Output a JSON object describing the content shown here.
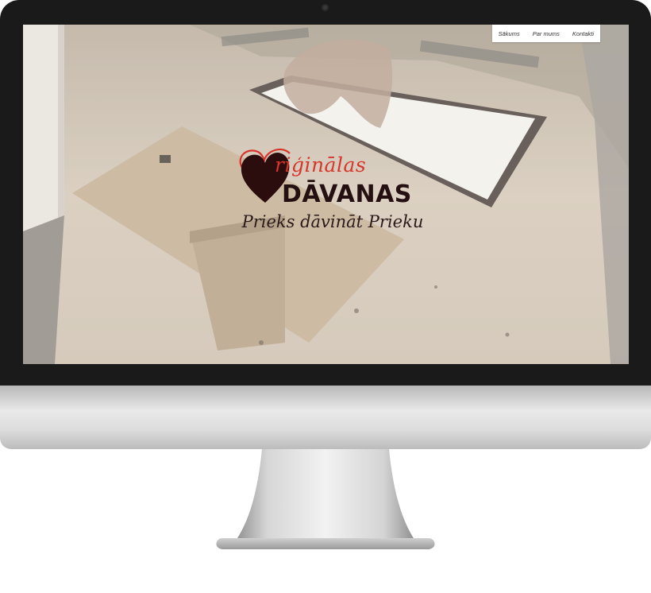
{
  "nav": {
    "items": [
      {
        "label": "Sākums"
      },
      {
        "label": "Par mums"
      },
      {
        "label": "Kontakti"
      }
    ]
  },
  "logo": {
    "top_text": "riģinālas",
    "main_text": "DĀVANAS",
    "tagline": "Prieks dāvināt Prieku",
    "heart_icon": "heart-icon",
    "colors": {
      "accent_red": "#d8352a",
      "heart": "#2b0d0d"
    }
  },
  "device": {
    "icon": "imac-monitor"
  }
}
